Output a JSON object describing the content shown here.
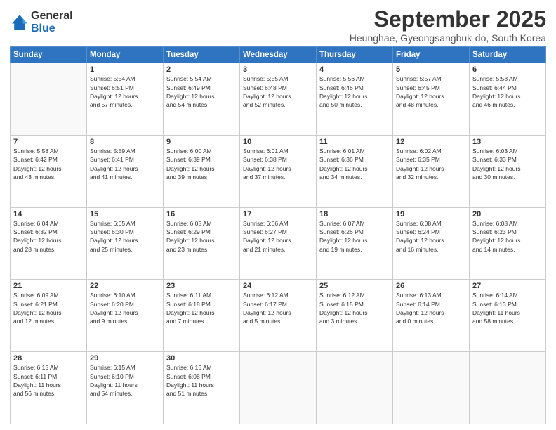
{
  "logo": {
    "general": "General",
    "blue": "Blue"
  },
  "header": {
    "month_year": "September 2025",
    "location": "Heunghae, Gyeongsangbuk-do, South Korea"
  },
  "days_of_week": [
    "Sunday",
    "Monday",
    "Tuesday",
    "Wednesday",
    "Thursday",
    "Friday",
    "Saturday"
  ],
  "weeks": [
    [
      {
        "day": "",
        "info": ""
      },
      {
        "day": "1",
        "info": "Sunrise: 5:54 AM\nSunset: 6:51 PM\nDaylight: 12 hours\nand 57 minutes."
      },
      {
        "day": "2",
        "info": "Sunrise: 5:54 AM\nSunset: 6:49 PM\nDaylight: 12 hours\nand 54 minutes."
      },
      {
        "day": "3",
        "info": "Sunrise: 5:55 AM\nSunset: 6:48 PM\nDaylight: 12 hours\nand 52 minutes."
      },
      {
        "day": "4",
        "info": "Sunrise: 5:56 AM\nSunset: 6:46 PM\nDaylight: 12 hours\nand 50 minutes."
      },
      {
        "day": "5",
        "info": "Sunrise: 5:57 AM\nSunset: 6:45 PM\nDaylight: 12 hours\nand 48 minutes."
      },
      {
        "day": "6",
        "info": "Sunrise: 5:58 AM\nSunset: 6:44 PM\nDaylight: 12 hours\nand 46 minutes."
      }
    ],
    [
      {
        "day": "7",
        "info": "Sunrise: 5:58 AM\nSunset: 6:42 PM\nDaylight: 12 hours\nand 43 minutes."
      },
      {
        "day": "8",
        "info": "Sunrise: 5:59 AM\nSunset: 6:41 PM\nDaylight: 12 hours\nand 41 minutes."
      },
      {
        "day": "9",
        "info": "Sunrise: 6:00 AM\nSunset: 6:39 PM\nDaylight: 12 hours\nand 39 minutes."
      },
      {
        "day": "10",
        "info": "Sunrise: 6:01 AM\nSunset: 6:38 PM\nDaylight: 12 hours\nand 37 minutes."
      },
      {
        "day": "11",
        "info": "Sunrise: 6:01 AM\nSunset: 6:36 PM\nDaylight: 12 hours\nand 34 minutes."
      },
      {
        "day": "12",
        "info": "Sunrise: 6:02 AM\nSunset: 6:35 PM\nDaylight: 12 hours\nand 32 minutes."
      },
      {
        "day": "13",
        "info": "Sunrise: 6:03 AM\nSunset: 6:33 PM\nDaylight: 12 hours\nand 30 minutes."
      }
    ],
    [
      {
        "day": "14",
        "info": "Sunrise: 6:04 AM\nSunset: 6:32 PM\nDaylight: 12 hours\nand 28 minutes."
      },
      {
        "day": "15",
        "info": "Sunrise: 6:05 AM\nSunset: 6:30 PM\nDaylight: 12 hours\nand 25 minutes."
      },
      {
        "day": "16",
        "info": "Sunrise: 6:05 AM\nSunset: 6:29 PM\nDaylight: 12 hours\nand 23 minutes."
      },
      {
        "day": "17",
        "info": "Sunrise: 6:06 AM\nSunset: 6:27 PM\nDaylight: 12 hours\nand 21 minutes."
      },
      {
        "day": "18",
        "info": "Sunrise: 6:07 AM\nSunset: 6:26 PM\nDaylight: 12 hours\nand 19 minutes."
      },
      {
        "day": "19",
        "info": "Sunrise: 6:08 AM\nSunset: 6:24 PM\nDaylight: 12 hours\nand 16 minutes."
      },
      {
        "day": "20",
        "info": "Sunrise: 6:08 AM\nSunset: 6:23 PM\nDaylight: 12 hours\nand 14 minutes."
      }
    ],
    [
      {
        "day": "21",
        "info": "Sunrise: 6:09 AM\nSunset: 6:21 PM\nDaylight: 12 hours\nand 12 minutes."
      },
      {
        "day": "22",
        "info": "Sunrise: 6:10 AM\nSunset: 6:20 PM\nDaylight: 12 hours\nand 9 minutes."
      },
      {
        "day": "23",
        "info": "Sunrise: 6:11 AM\nSunset: 6:18 PM\nDaylight: 12 hours\nand 7 minutes."
      },
      {
        "day": "24",
        "info": "Sunrise: 6:12 AM\nSunset: 6:17 PM\nDaylight: 12 hours\nand 5 minutes."
      },
      {
        "day": "25",
        "info": "Sunrise: 6:12 AM\nSunset: 6:15 PM\nDaylight: 12 hours\nand 3 minutes."
      },
      {
        "day": "26",
        "info": "Sunrise: 6:13 AM\nSunset: 6:14 PM\nDaylight: 12 hours\nand 0 minutes."
      },
      {
        "day": "27",
        "info": "Sunrise: 6:14 AM\nSunset: 6:13 PM\nDaylight: 11 hours\nand 58 minutes."
      }
    ],
    [
      {
        "day": "28",
        "info": "Sunrise: 6:15 AM\nSunset: 6:11 PM\nDaylight: 11 hours\nand 56 minutes."
      },
      {
        "day": "29",
        "info": "Sunrise: 6:15 AM\nSunset: 6:10 PM\nDaylight: 11 hours\nand 54 minutes."
      },
      {
        "day": "30",
        "info": "Sunrise: 6:16 AM\nSunset: 6:08 PM\nDaylight: 11 hours\nand 51 minutes."
      },
      {
        "day": "",
        "info": ""
      },
      {
        "day": "",
        "info": ""
      },
      {
        "day": "",
        "info": ""
      },
      {
        "day": "",
        "info": ""
      }
    ]
  ]
}
